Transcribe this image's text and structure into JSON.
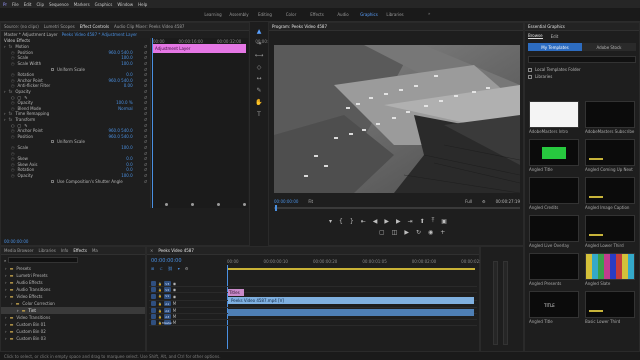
{
  "menu": [
    "File",
    "Edit",
    "Clip",
    "Sequence",
    "Markers",
    "Graphics",
    "Window",
    "Help"
  ],
  "workspaces": {
    "items": [
      "Learning",
      "Assembly",
      "Editing",
      "Color",
      "Effects",
      "Audio",
      "Graphics",
      "Libraries"
    ],
    "active": "Graphics"
  },
  "source_tabs": [
    "Source: (no clips)",
    "Lumetri Scopes",
    "Effect Controls",
    "Audio Clip Mixer: Peeks Video 4587"
  ],
  "source_active_tab": "Effect Controls",
  "effect_controls": {
    "master": "Master * Adjustment Layer",
    "clip": "Peeks Video 4587 * Adjustment Layer",
    "section": "Video Effects",
    "rows": [
      {
        "label": "Motion",
        "kind": "group"
      },
      {
        "label": "Position",
        "value": "960.0  540.0"
      },
      {
        "label": "Scale",
        "value": "100.0"
      },
      {
        "label": "Scale Width",
        "value": "100.0"
      },
      {
        "label": "Uniform Scale",
        "kind": "check"
      },
      {
        "label": "Rotation",
        "value": "0.0"
      },
      {
        "label": "Anchor Point",
        "value": "960.0  540.0"
      },
      {
        "label": "Anti-flicker Filter",
        "value": "0.00"
      },
      {
        "label": "Opacity",
        "kind": "group"
      },
      {
        "label": "",
        "kind": "shapes"
      },
      {
        "label": "Opacity",
        "value": "100.0 %"
      },
      {
        "label": "Blend Mode",
        "value": "Normal"
      },
      {
        "label": "Time Remapping",
        "kind": "group"
      },
      {
        "label": "Transform",
        "kind": "group"
      },
      {
        "label": "",
        "kind": "shapes"
      },
      {
        "label": "Anchor Point",
        "value": "960.0  540.0"
      },
      {
        "label": "Position",
        "value": "960.0  540.0"
      },
      {
        "label": "Uniform Scale",
        "kind": "check"
      },
      {
        "label": "Scale",
        "value": "100.0"
      },
      {
        "label": "",
        "kind": "blank"
      },
      {
        "label": "Skew",
        "value": "0.0"
      },
      {
        "label": "Skew Axis",
        "value": "0.0"
      },
      {
        "label": "Rotation",
        "value": "0.0"
      },
      {
        "label": "Opacity",
        "value": "100.0"
      },
      {
        "label": "Use Composition's Shutter Angle",
        "kind": "check"
      }
    ],
    "mini_timeline": {
      "ticks": [
        "00:00",
        "00:00:16:00",
        "00:00:32:00",
        "00:00:48:00"
      ],
      "clip_label": "Adjustment Layer"
    },
    "timecode": "00:00:00:00"
  },
  "program": {
    "title": "Program: Peeks Video 4587",
    "timecode_left": "00:00:00:00",
    "fit": "Fit",
    "quality": "Full",
    "timecode_right": "00:00:27:19"
  },
  "essential_graphics": {
    "title": "Essential Graphics",
    "tabs": [
      "Browse",
      "Edit"
    ],
    "active_tab": "Browse",
    "sources": [
      "My Templates",
      "Adobe Stock"
    ],
    "search_placeholder": "",
    "filters": [
      "Local Templates Folder",
      "Libraries"
    ],
    "templates": [
      "AdobeMasters Intro",
      "AdobeMasters Subscribe",
      "Angled Title",
      "Angled Coming Up Next",
      "Angled Credits",
      "Angled Image Caption",
      "Angled Live Overlay",
      "Angled Lower Third",
      "Angled Presents",
      "Angled Slate",
      "Angled Title",
      "Basic Lower Third"
    ],
    "slate_text": "TITLE"
  },
  "project_tabs": [
    "Media Browser",
    "Libraries",
    "Info",
    "Effects",
    "Ma"
  ],
  "project_active_tab": "Effects",
  "effects_tree": [
    {
      "label": "Presets",
      "level": 0
    },
    {
      "label": "Lumetri Presets",
      "level": 0
    },
    {
      "label": "Audio Effects",
      "level": 0
    },
    {
      "label": "Audio Transitions",
      "level": 0
    },
    {
      "label": "Video Effects",
      "level": 0
    },
    {
      "label": "Color Correction",
      "level": 1
    },
    {
      "label": "Tint",
      "level": 2,
      "selected": true
    },
    {
      "label": "Video Transitions",
      "level": 0
    },
    {
      "label": "Custom Bin 01",
      "level": 0
    },
    {
      "label": "Custom Bin 02",
      "level": 0
    },
    {
      "label": "Custom Bin 03",
      "level": 0
    }
  ],
  "timeline": {
    "tab": "Peeks Video 4587",
    "timecode": "00:00:00:00",
    "ruler": [
      "00:00",
      "00:00:00:10",
      "00:00:00:20",
      "00:00:01:05",
      "00:00:02:00",
      "00:00:02:15"
    ],
    "tracks": [
      "V3",
      "V2",
      "V1",
      "A1",
      "A2",
      "A3",
      "Master"
    ],
    "clips": {
      "v3": "Titles",
      "v2": "Peeks Video 4587.mp4 [V]",
      "a1": ""
    }
  },
  "statusbar": "Click to select, or click in empty space and drag to marquee select. Use Shift, Alt, and Ctrl for other options."
}
